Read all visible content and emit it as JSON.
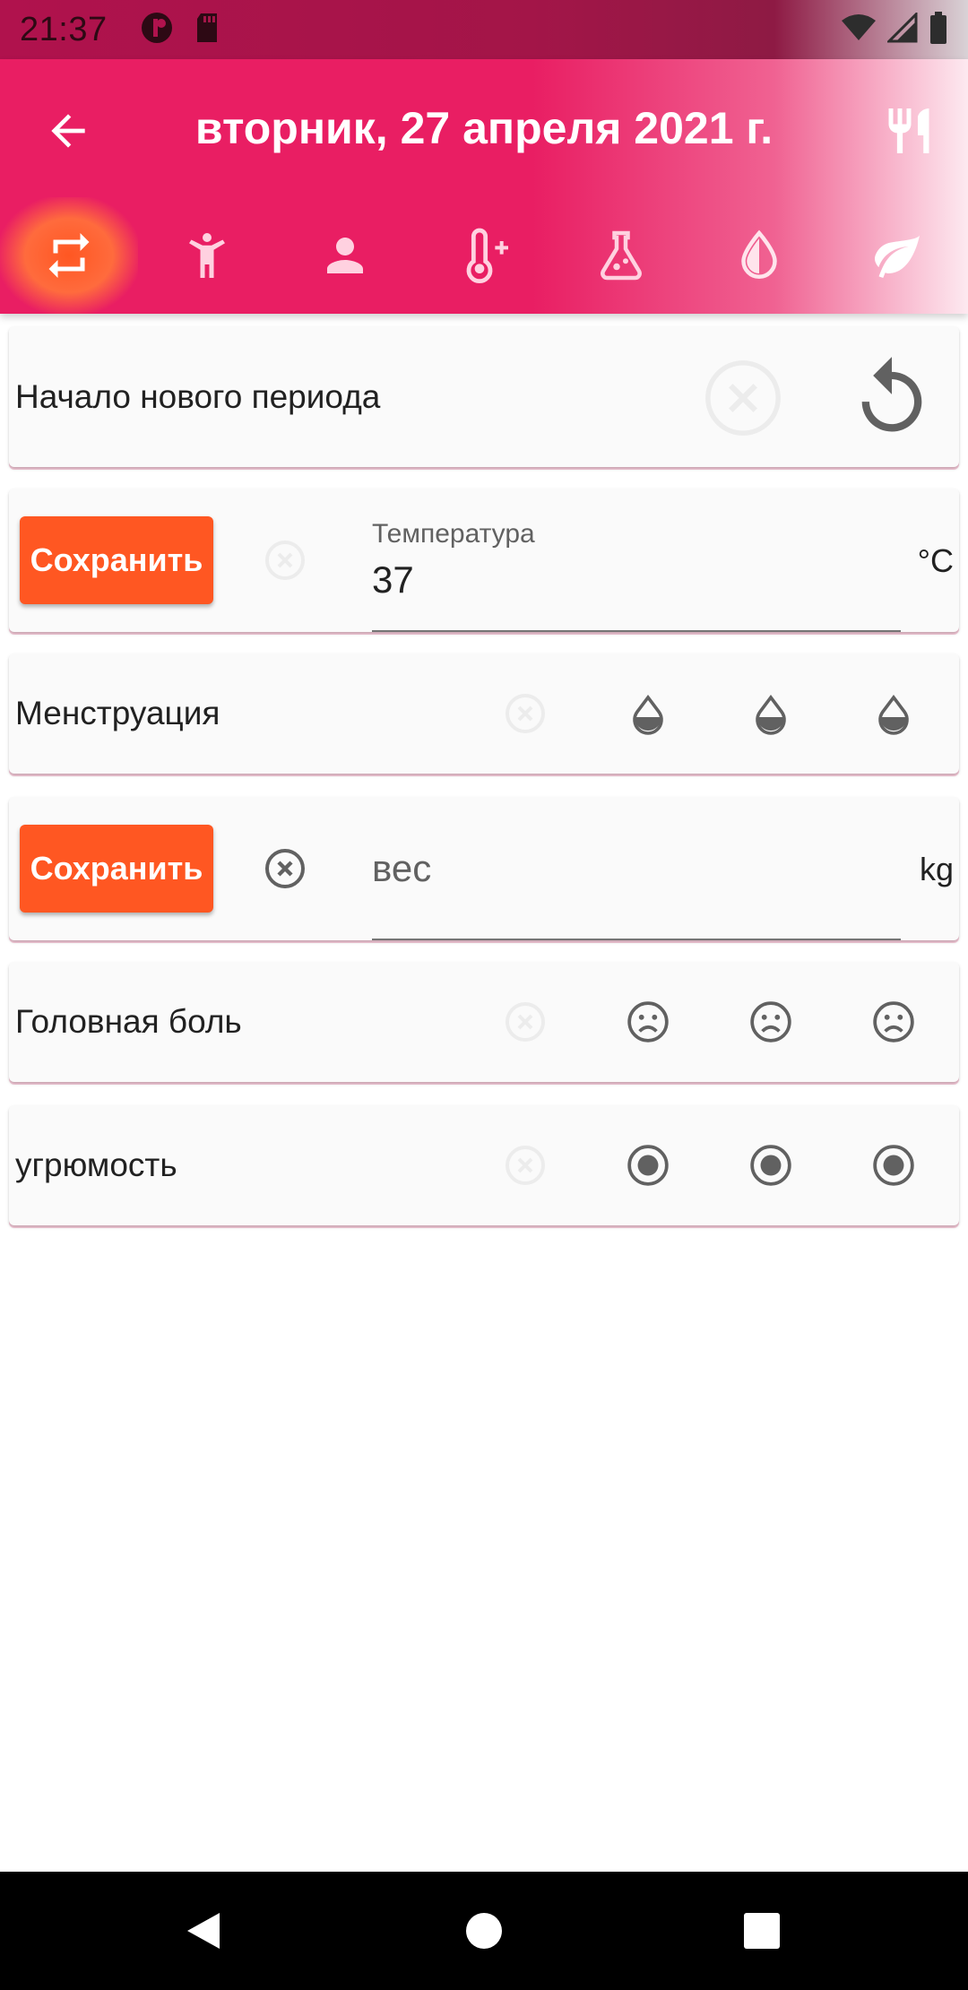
{
  "status_bar": {
    "time": "21:37"
  },
  "header": {
    "title": "вторник, 27 апреля 2021 г.",
    "tabs": [
      {
        "icon": "repeat-icon",
        "active": true
      },
      {
        "icon": "exercise-figure-icon",
        "active": false
      },
      {
        "icon": "person-icon",
        "active": false
      },
      {
        "icon": "thermometer-plus-icon",
        "active": false
      },
      {
        "icon": "flask-icon",
        "active": false
      },
      {
        "icon": "drop-icon",
        "active": false
      },
      {
        "icon": "leaf-icon",
        "active": false
      }
    ]
  },
  "cards": {
    "new_period": {
      "label": "Начало нового периода"
    },
    "temperature": {
      "save_label": "Сохранить",
      "field_label": "Температура",
      "value": "37",
      "unit": "°C"
    },
    "menstruation": {
      "label": "Менструация"
    },
    "weight": {
      "save_label": "Сохранить",
      "placeholder": "вес",
      "unit": "kg"
    },
    "headache": {
      "label": "Головная боль"
    },
    "gloominess": {
      "label": "угрюмость"
    }
  },
  "colors": {
    "accent": "#e91e63",
    "button": "#ff5722",
    "icon_gray": "#616161"
  }
}
